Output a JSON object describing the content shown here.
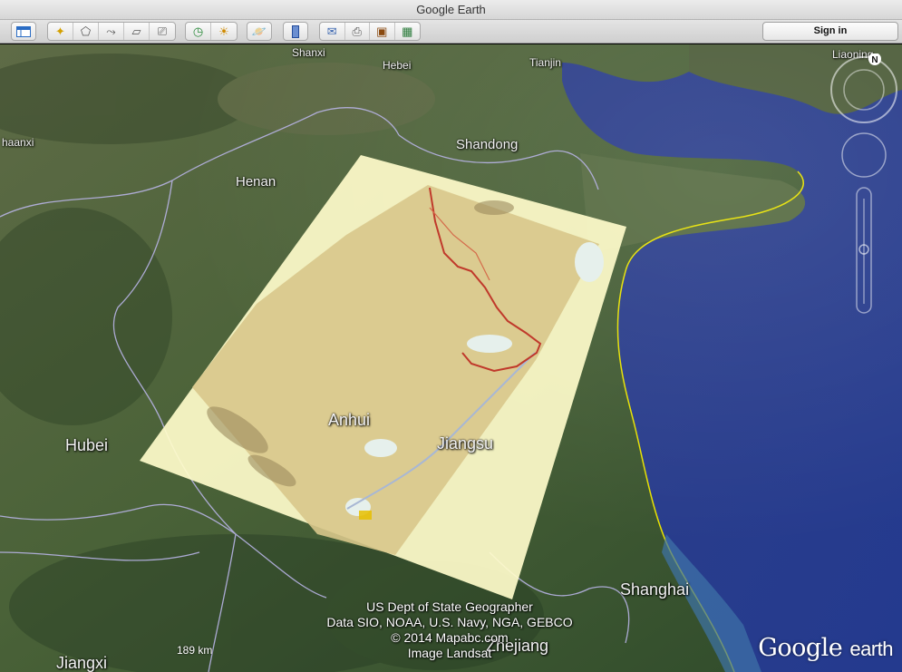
{
  "window": {
    "title": "Google Earth"
  },
  "toolbar": {
    "sign_in_label": "Sign in",
    "buttons": [
      {
        "name": "sidebar-toggle-button",
        "icon": "sidebar-icon"
      },
      {
        "name": "add-placemark-button",
        "icon": "placemark-icon"
      },
      {
        "name": "add-polygon-button",
        "icon": "polygon-icon"
      },
      {
        "name": "add-path-button",
        "icon": "path-icon"
      },
      {
        "name": "add-image-overlay-button",
        "icon": "image-overlay-icon"
      },
      {
        "name": "record-tour-button",
        "icon": "tour-icon"
      },
      {
        "name": "historical-imagery-button",
        "icon": "clock-icon"
      },
      {
        "name": "sunlight-button",
        "icon": "sun-icon"
      },
      {
        "name": "switch-planet-button",
        "icon": "planet-icon"
      },
      {
        "name": "ruler-button",
        "icon": "ruler-icon"
      },
      {
        "name": "email-button",
        "icon": "email-icon"
      },
      {
        "name": "print-button",
        "icon": "print-icon"
      },
      {
        "name": "save-image-button",
        "icon": "save-image-icon"
      },
      {
        "name": "view-in-maps-button",
        "icon": "maps-icon"
      }
    ]
  },
  "map": {
    "labels": {
      "shanxi": "Shanxi",
      "hebei": "Hebei",
      "tianjin": "Tianjin",
      "liaoning": "Liaoning",
      "shaanxi": "haanxi",
      "shandong": "Shandong",
      "henan": "Henan",
      "hubei": "Hubei",
      "anhui": "Anhui",
      "jiangsu": "Jiangsu",
      "shanghai": "Shanghai",
      "jiangxi": "Jiangxi",
      "zhejiang": "Zhejiang"
    },
    "attribution": [
      "US Dept of State Geographer",
      "Data SIO, NOAA, U.S. Navy, NGA, GEBCO",
      "© 2014 Mapabc.com",
      "Image Landsat"
    ],
    "scale_label": "189 km",
    "compass_letter": "N",
    "logo": {
      "word1": "Google",
      "word2": "earth"
    },
    "colors": {
      "land": "#3f5a34",
      "sea": "#2f4a9a",
      "overlay_frame": "#fffccb",
      "overlay_map": "#dccb8e",
      "border": "#b8b4e6",
      "coast": "#e6e000",
      "route": "#c0392b"
    }
  }
}
